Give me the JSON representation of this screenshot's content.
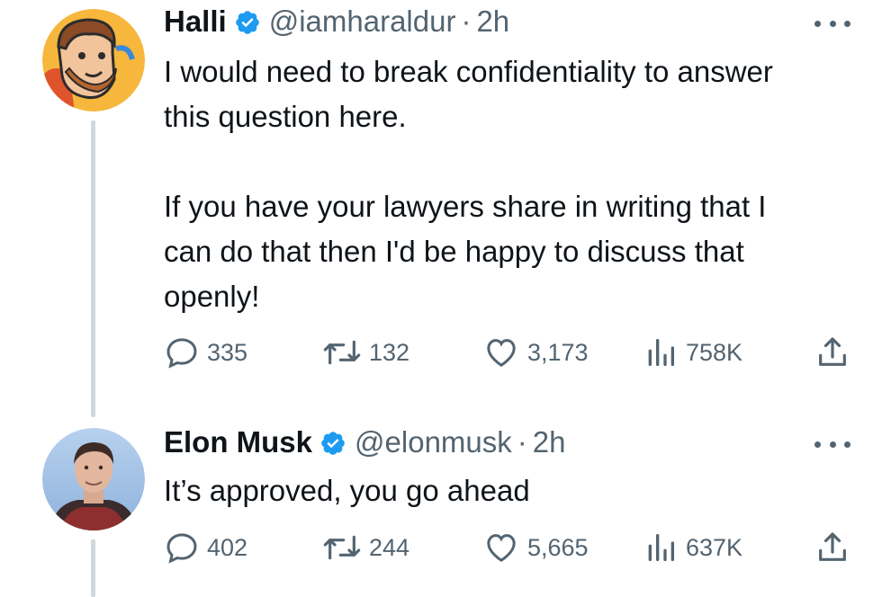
{
  "tweets": [
    {
      "name": "Halli",
      "handle": "@iamharaldur",
      "dot": "·",
      "time": "2h",
      "text": [
        "I would need to break confidentiality to answer this question here.",
        "If you have your lawyers share in writing that I can do that then I'd be happy to discuss that openly!"
      ],
      "replies": "335",
      "retweets": "132",
      "likes": "3,173",
      "views": "758K",
      "avatar_icon": "cartoon-avatar"
    },
    {
      "name": "Elon Musk",
      "handle": "@elonmusk",
      "dot": "·",
      "time": "2h",
      "text": [
        "It’s approved, you go ahead"
      ],
      "replies": "402",
      "retweets": "244",
      "likes": "5,665",
      "views": "637K",
      "avatar_icon": "photo-avatar"
    }
  ],
  "colors": {
    "text": "#0f1419",
    "secondary": "#536471",
    "verified": "#1d9bf0",
    "thread_line": "#cfd9de",
    "avatar_bg_1": "#f6b73c",
    "avatar_bg_2": "#a9c7e8"
  },
  "icons": [
    "verified-badge-icon",
    "more-icon",
    "reply-icon",
    "retweet-icon",
    "like-icon",
    "views-icon",
    "share-icon"
  ]
}
